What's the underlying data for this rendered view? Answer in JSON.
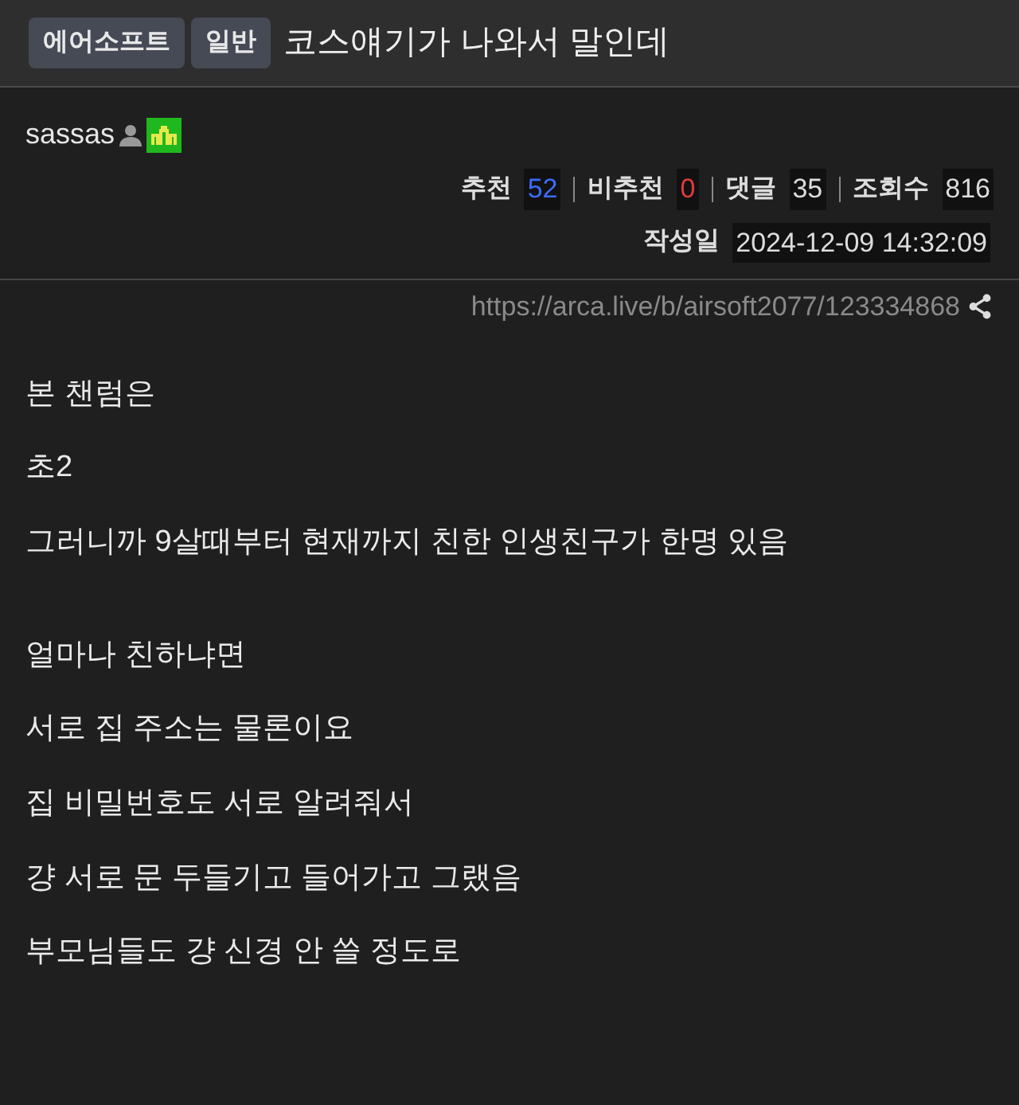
{
  "header": {
    "badges": [
      "에어소프트",
      "일반"
    ],
    "title": "코스얘기가 나와서 말인데"
  },
  "author": {
    "name": "sassas"
  },
  "stats": [
    {
      "label": "추천",
      "value": "52",
      "color": "#3b6cff"
    },
    {
      "label": "비추천",
      "value": "0",
      "color": "#e03a3a"
    },
    {
      "label": "댓글",
      "value": "35",
      "color": "#dddddd"
    },
    {
      "label": "조회수",
      "value": "816",
      "color": "#dddddd"
    }
  ],
  "date": {
    "label": "작성일",
    "value": "2024-12-09 14:32:09"
  },
  "url": "https://arca.live/b/airsoft2077/123334868",
  "paragraphs": [
    [
      "본 챈럼은",
      "초2",
      "그러니까 9살때부터 현재까지 친한 인생친구가 한명 있음"
    ],
    [
      "얼마나 친하냐면",
      "서로 집 주소는 물론이요",
      "집 비밀번호도 서로 알려줘서",
      "걍 서로 문 두들기고 들어가고 그랬음",
      "부모님들도 걍 신경 안 쓸 정도로"
    ]
  ]
}
